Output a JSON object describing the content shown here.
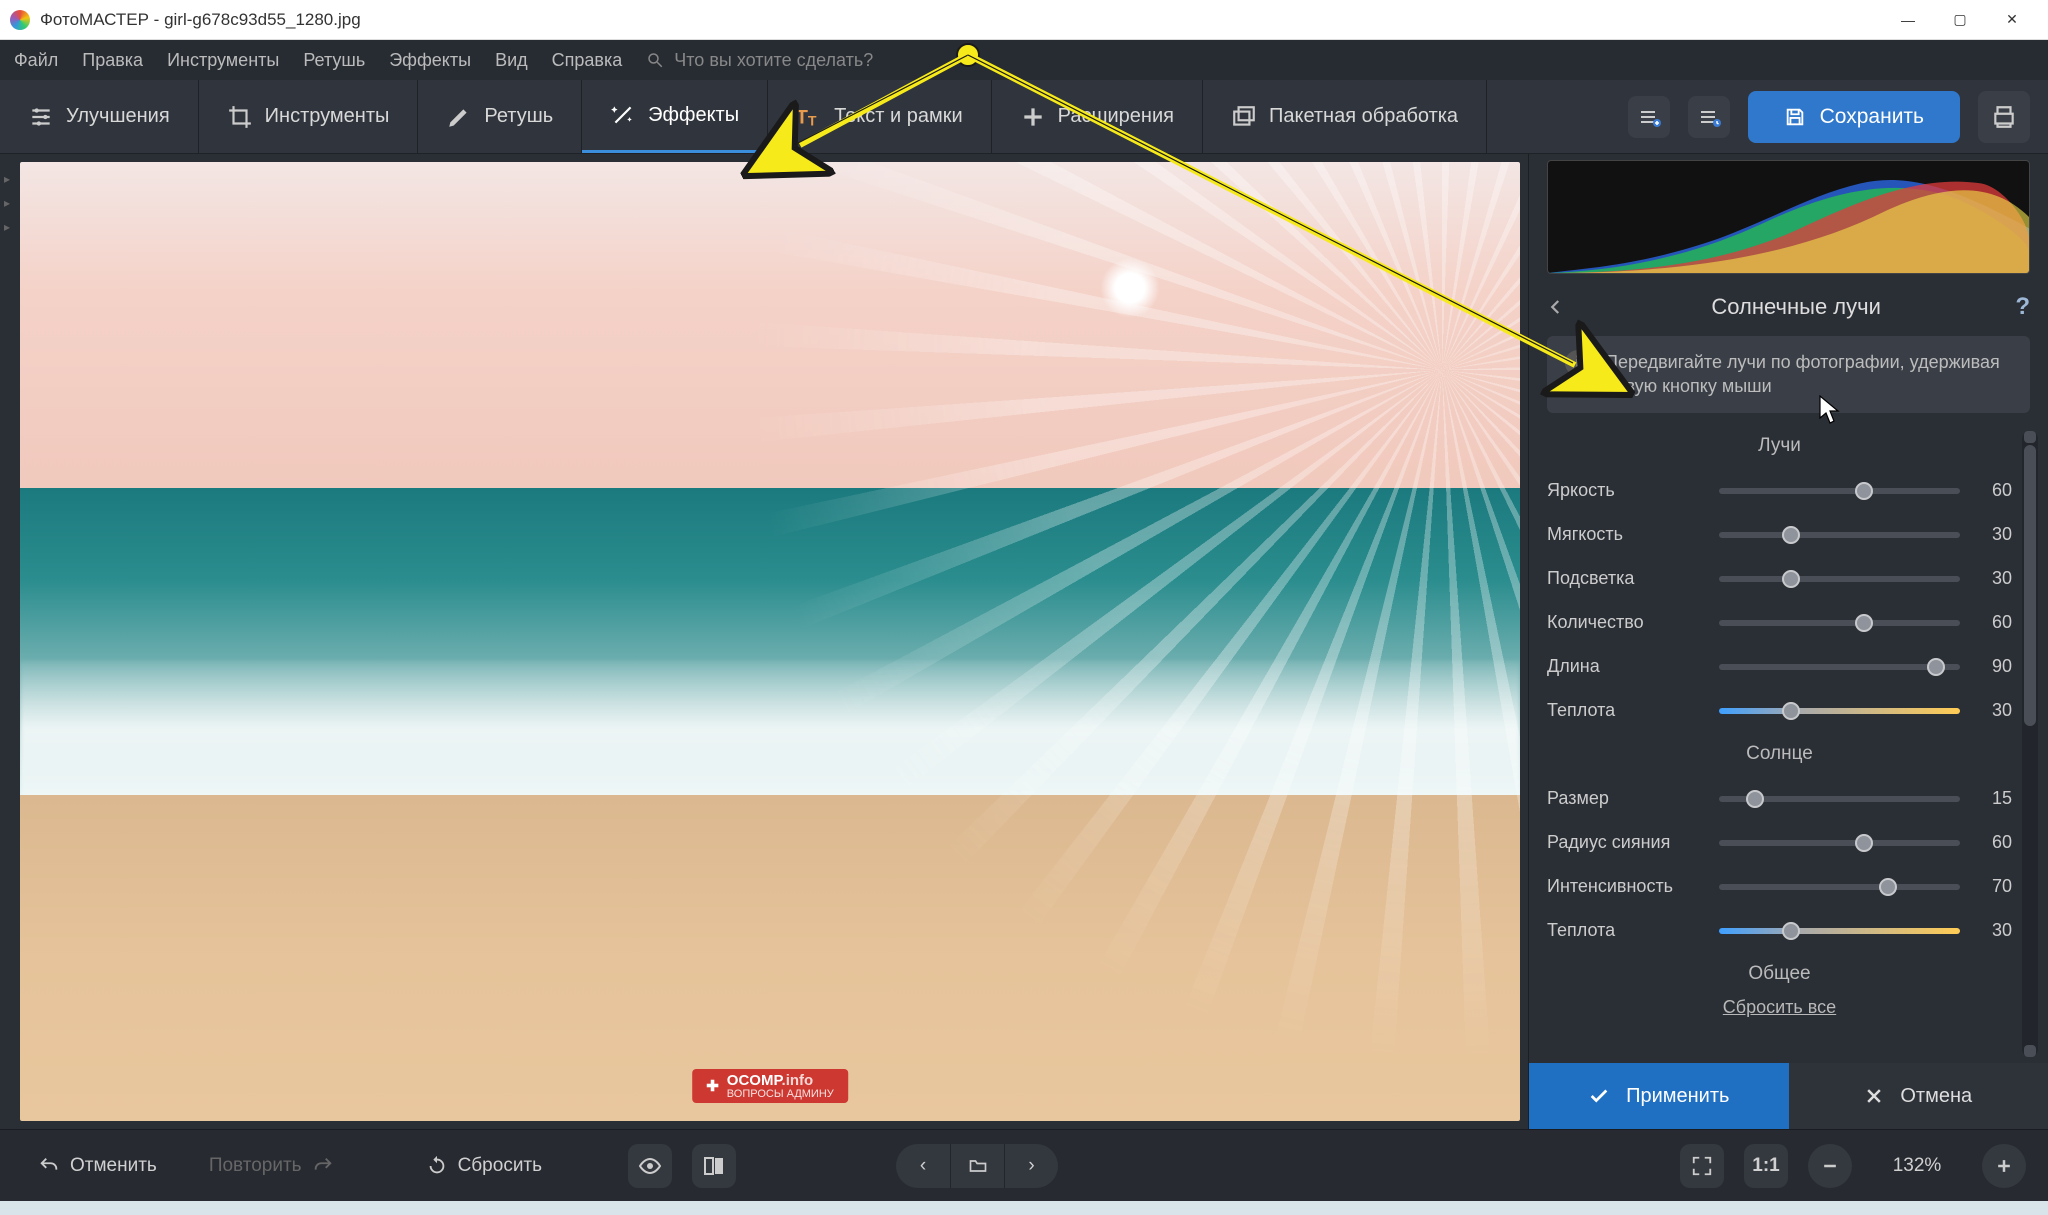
{
  "title": "ФотоМАСТЕР - girl-g678c93d55_1280.jpg",
  "menu": {
    "file": "Файл",
    "edit": "Правка",
    "tools": "Инструменты",
    "retouch": "Ретушь",
    "effects": "Эффекты",
    "view": "Вид",
    "help": "Справка",
    "search_ph": "Что вы хотите сделать?"
  },
  "tabs": {
    "enhance": "Улучшения",
    "tools": "Инструменты",
    "retouch": "Ретушь",
    "effects": "Эффекты",
    "text": "Текст и рамки",
    "ext": "Расширения",
    "batch": "Пакетная обработка"
  },
  "save": "Сохранить",
  "panel": {
    "title": "Солнечные лучи",
    "hint": "Передвигайте лучи по фотографии, удерживая левую кнопку мыши",
    "group1": "Лучи",
    "group2": "Солнце",
    "group3": "Общее",
    "reset": "Сбросить все"
  },
  "sliders": {
    "brightness": {
      "l": "Яркость",
      "v": 60
    },
    "softness": {
      "l": "Мягкость",
      "v": 30
    },
    "backlight": {
      "l": "Подсветка",
      "v": 30
    },
    "count": {
      "l": "Количество",
      "v": 60
    },
    "length": {
      "l": "Длина",
      "v": 90
    },
    "warmth1": {
      "l": "Теплота",
      "v": 30
    },
    "size": {
      "l": "Размер",
      "v": 15
    },
    "radius": {
      "l": "Радиус сияния",
      "v": 60
    },
    "intensity": {
      "l": "Интенсивность",
      "v": 70
    },
    "warmth2": {
      "l": "Теплота",
      "v": 30
    }
  },
  "actions": {
    "apply": "Применить",
    "cancel": "Отмена"
  },
  "bottom": {
    "undo": "Отменить",
    "redo": "Повторить",
    "reset": "Сбросить",
    "zoom": "132%",
    "fit": "1:1"
  },
  "watermark": {
    "brand": "OCOMP",
    "tld": ".info",
    "sub": "ВОПРОСЫ АДМИНУ"
  }
}
